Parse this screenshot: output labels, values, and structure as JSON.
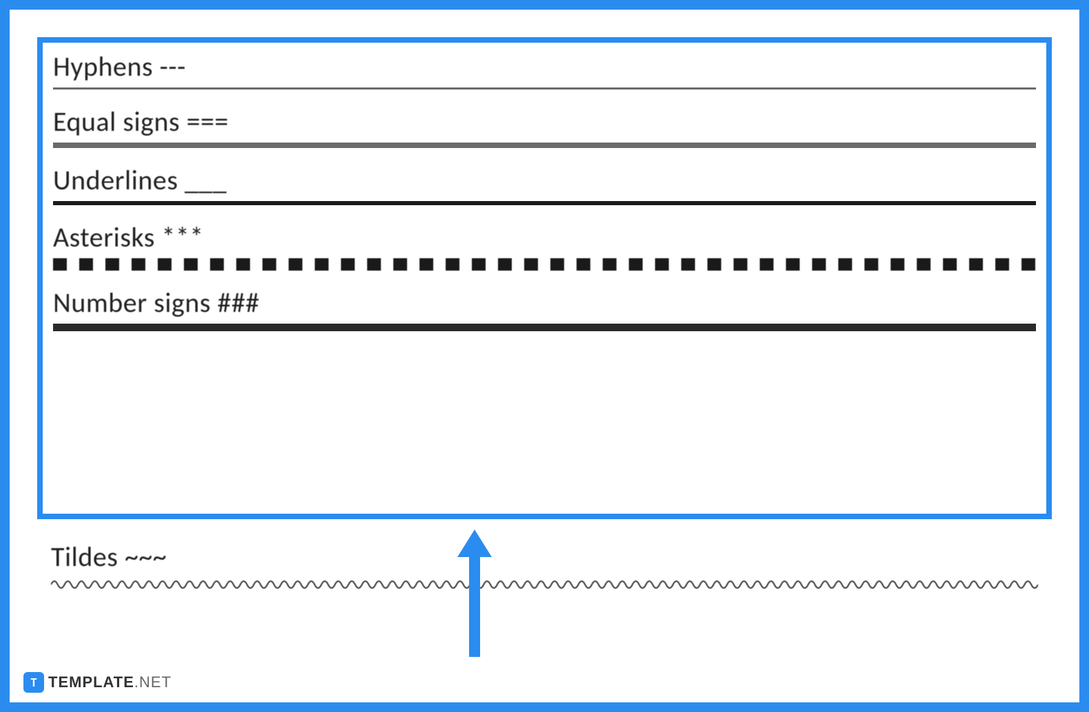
{
  "items": [
    {
      "label": "Hyphens ---",
      "style": "thin"
    },
    {
      "label": "Equal signs ===",
      "style": "double"
    },
    {
      "label": "Underlines ___",
      "style": "thick"
    },
    {
      "label": "Asterisks ***",
      "style": "dotted"
    },
    {
      "label": "Number signs ###",
      "style": "triple"
    }
  ],
  "below": {
    "label": "Tildes ~~~",
    "style": "wave"
  },
  "watermark": {
    "logo_letter": "T",
    "brand_bold": "TEMPLATE",
    "brand_light": ".NET"
  },
  "colors": {
    "accent": "#2b8cf0"
  }
}
